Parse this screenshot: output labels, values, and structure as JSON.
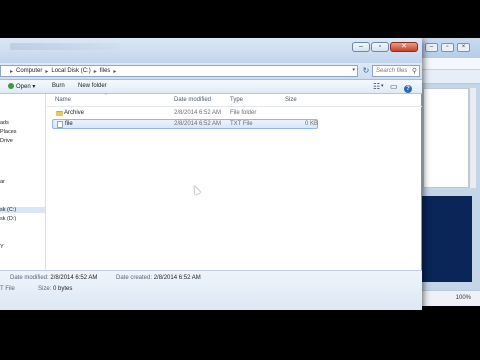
{
  "background_window": {
    "zoom": "100%"
  },
  "explorer": {
    "address": {
      "crumbs": [
        "Computer",
        "Local Disk (C:)",
        "files"
      ]
    },
    "search": {
      "placeholder": "Search files"
    },
    "toolbar": {
      "open_label": "Open",
      "burn_label": "Burn",
      "new_folder_label": "New folder"
    },
    "navpane": {
      "items": [
        "ads",
        "Places",
        "Drive",
        "ar",
        "sk (C:)",
        "sk (D:)",
        "Y"
      ]
    },
    "columns": {
      "name": "Name",
      "date_modified": "Date modified",
      "type": "Type",
      "size": "Size"
    },
    "files": [
      {
        "name": "Archive",
        "date_modified": "2/8/2014 6:52 AM",
        "type": "File folder",
        "size": "",
        "kind": "folder",
        "selected": false
      },
      {
        "name": "file",
        "date_modified": "2/8/2014 6:52 AM",
        "type": "TXT File",
        "size": "0 KB",
        "kind": "file",
        "selected": true
      }
    ],
    "details": {
      "date_modified_label": "Date modified:",
      "date_modified_value": "2/8/2014 6:52 AM",
      "date_created_label": "Date created:",
      "date_created_value": "2/8/2014 6:52 AM",
      "size_label": "Size:",
      "size_value": "0 bytes",
      "type_value": "T File"
    }
  }
}
